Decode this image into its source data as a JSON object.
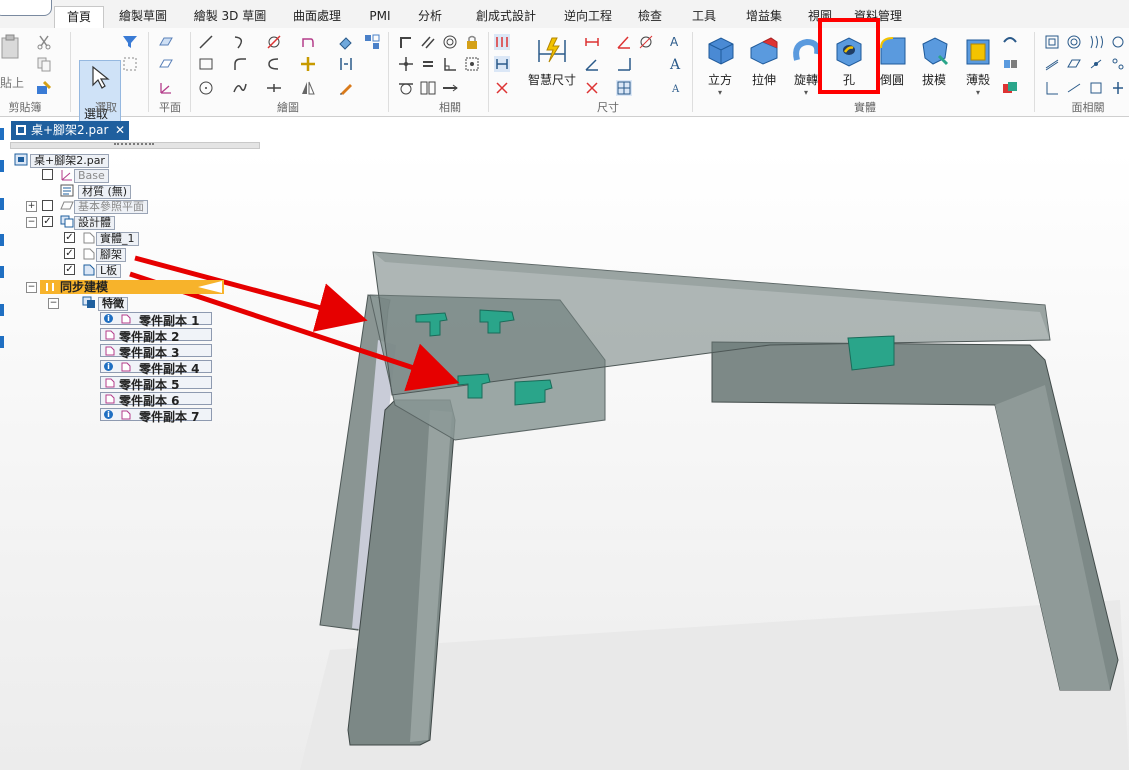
{
  "tabs": [
    "首頁",
    "繪製草圖",
    "繪製 3D 草圖",
    "曲面處理",
    "PMI",
    "分析",
    "創成式設計",
    "逆向工程",
    "檢查",
    "工具",
    "增益集",
    "視圖",
    "資料管理"
  ],
  "ribbon": {
    "clipboard": {
      "paste_label": "貼上",
      "group_label": "剪貼簿"
    },
    "select": {
      "label": "選取",
      "group_label": "選取"
    },
    "plane": {
      "group_label": "平面"
    },
    "draw": {
      "group_label": "繪圖"
    },
    "relate": {
      "group_label": "相關"
    },
    "dimension": {
      "smart_label": "智慧尺寸",
      "group_label": "尺寸"
    },
    "solids": {
      "group_label": "實體",
      "items": [
        {
          "label": "立方"
        },
        {
          "label": "拉伸"
        },
        {
          "label": "旋轉"
        },
        {
          "label": "孔"
        },
        {
          "label": "倒圓"
        },
        {
          "label": "拔模"
        },
        {
          "label": "薄殼"
        }
      ]
    },
    "face": {
      "group_label": "面相關"
    }
  },
  "document_tab": {
    "title": "桌+腳架2.par",
    "close": "✕"
  },
  "tree": {
    "root": "桌+腳架2.par",
    "base": "Base",
    "material": "材質 (無)",
    "ref_planes": "基本參照平面",
    "design_body": "設計體",
    "bodies": [
      "實體_1",
      "腳架",
      "L板"
    ],
    "sync_modeling": "同步建模",
    "features_group": "特徵",
    "features": [
      {
        "label": "零件副本 1",
        "info": true
      },
      {
        "label": "零件副本 2",
        "info": false
      },
      {
        "label": "零件副本 3",
        "info": false
      },
      {
        "label": "零件副本 4",
        "info": true
      },
      {
        "label": "零件副本 5",
        "info": false
      },
      {
        "label": "零件副本 6",
        "info": false
      },
      {
        "label": "零件副本 7",
        "info": true
      }
    ]
  },
  "colors": {
    "highlight": "#ff0000",
    "arrow": "#e60000",
    "doc_tab": "#1f5f9e",
    "sync_bar": "#f7b32b",
    "model_body": "#6f7d7b",
    "model_connector": "#2aa58a"
  }
}
